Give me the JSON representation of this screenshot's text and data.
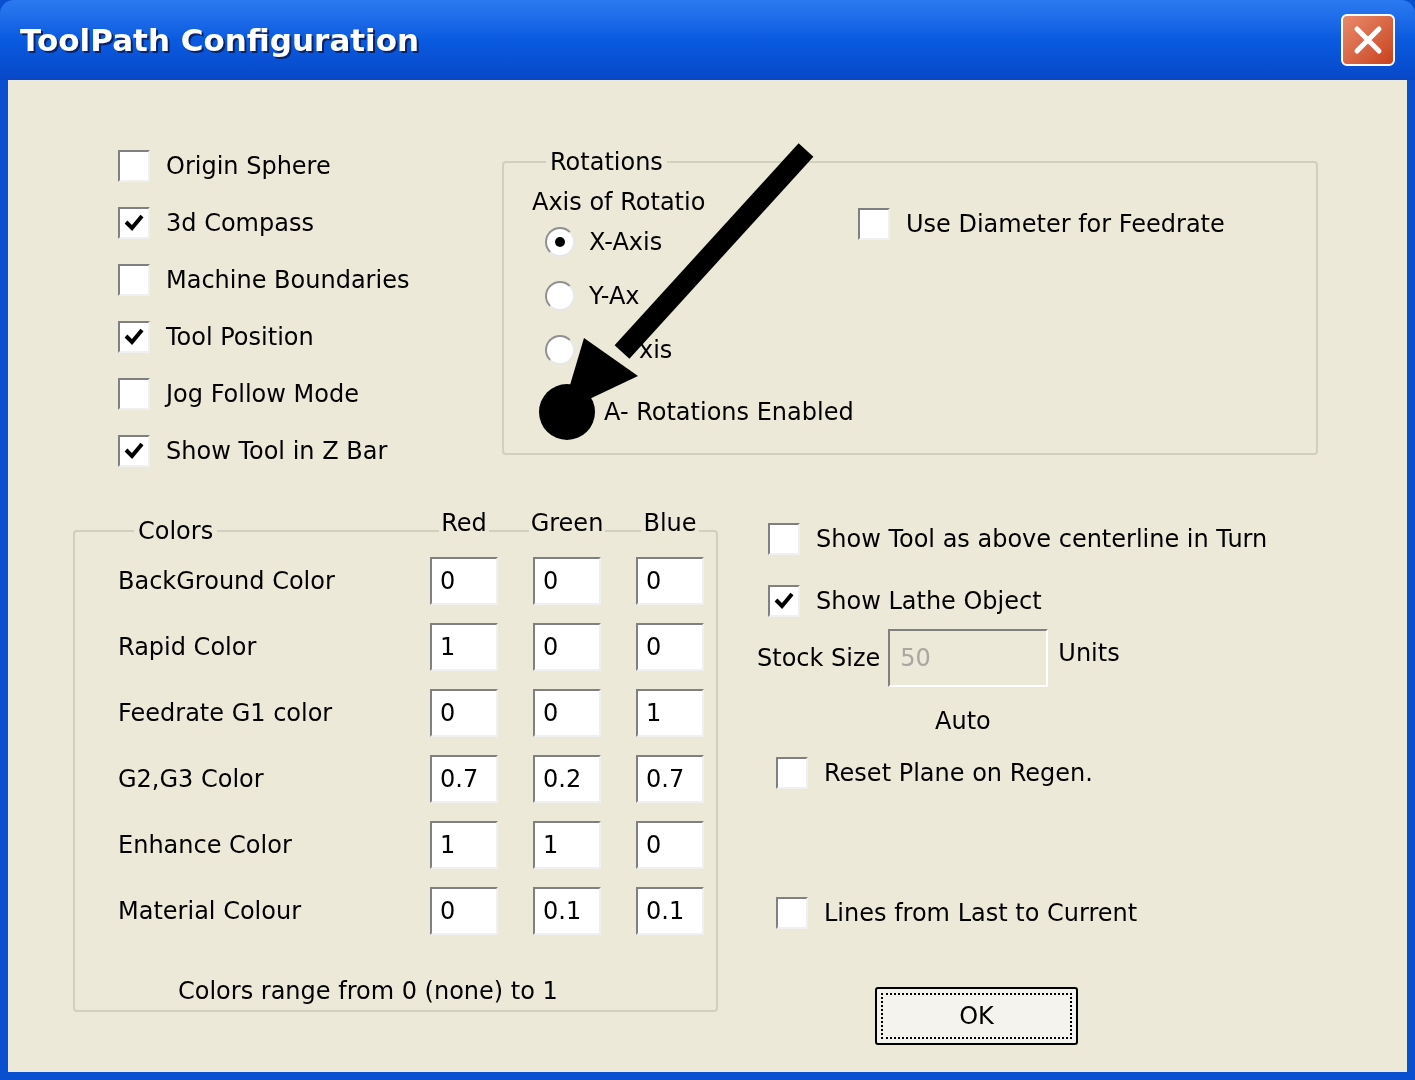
{
  "window": {
    "title": "ToolPath Configuration"
  },
  "display_options": [
    {
      "label": "Origin Sphere",
      "checked": false
    },
    {
      "label": "3d Compass",
      "checked": true
    },
    {
      "label": "Machine Boundaries",
      "checked": false
    },
    {
      "label": "Tool Position",
      "checked": true
    },
    {
      "label": "Jog Follow Mode",
      "checked": false
    },
    {
      "label": "Show Tool in Z Bar",
      "checked": true
    }
  ],
  "rotations": {
    "title": "Rotations",
    "axis_label": "Axis of Rotatio",
    "axes": [
      {
        "label": "X-Axis",
        "selected": true
      },
      {
        "label": "Y-Ax",
        "selected": false
      },
      {
        "label": "xis",
        "selected": false
      }
    ],
    "enable_label": "A- Rotations Enabled",
    "use_diameter": {
      "label": "Use Diameter for Feedrate",
      "checked": false
    }
  },
  "colors": {
    "title": "Colors",
    "columns": [
      "Red",
      "Green",
      "Blue"
    ],
    "rows": [
      {
        "label": "BackGround Color",
        "values": [
          "0",
          "0",
          "0"
        ]
      },
      {
        "label": "Rapid Color",
        "values": [
          "1",
          "0",
          "0"
        ]
      },
      {
        "label": "Feedrate G1 color",
        "values": [
          "0",
          "0",
          "1"
        ]
      },
      {
        "label": "G2,G3 Color",
        "values": [
          "0.7",
          "0.2",
          "0.7"
        ]
      },
      {
        "label": "Enhance Color",
        "values": [
          "1",
          "1",
          "0"
        ]
      },
      {
        "label": "Material Colour",
        "values": [
          "0",
          "0.1",
          "0.1"
        ]
      }
    ],
    "note": "Colors range from 0 (none) to 1"
  },
  "lathe_options": [
    {
      "label": "Show Tool as above centerline in Turn",
      "checked": false
    },
    {
      "label": "Show Lathe Object",
      "checked": true
    }
  ],
  "stock_size": {
    "label": "Stock Size",
    "value": "50",
    "disabled": true,
    "units": "Units",
    "auto_label": "Auto"
  },
  "reset_plane": {
    "label": "Reset Plane on Regen.",
    "checked": false
  },
  "lines_from_last": {
    "label": "Lines from Last to Current",
    "checked": false
  },
  "ok_button": "OK"
}
